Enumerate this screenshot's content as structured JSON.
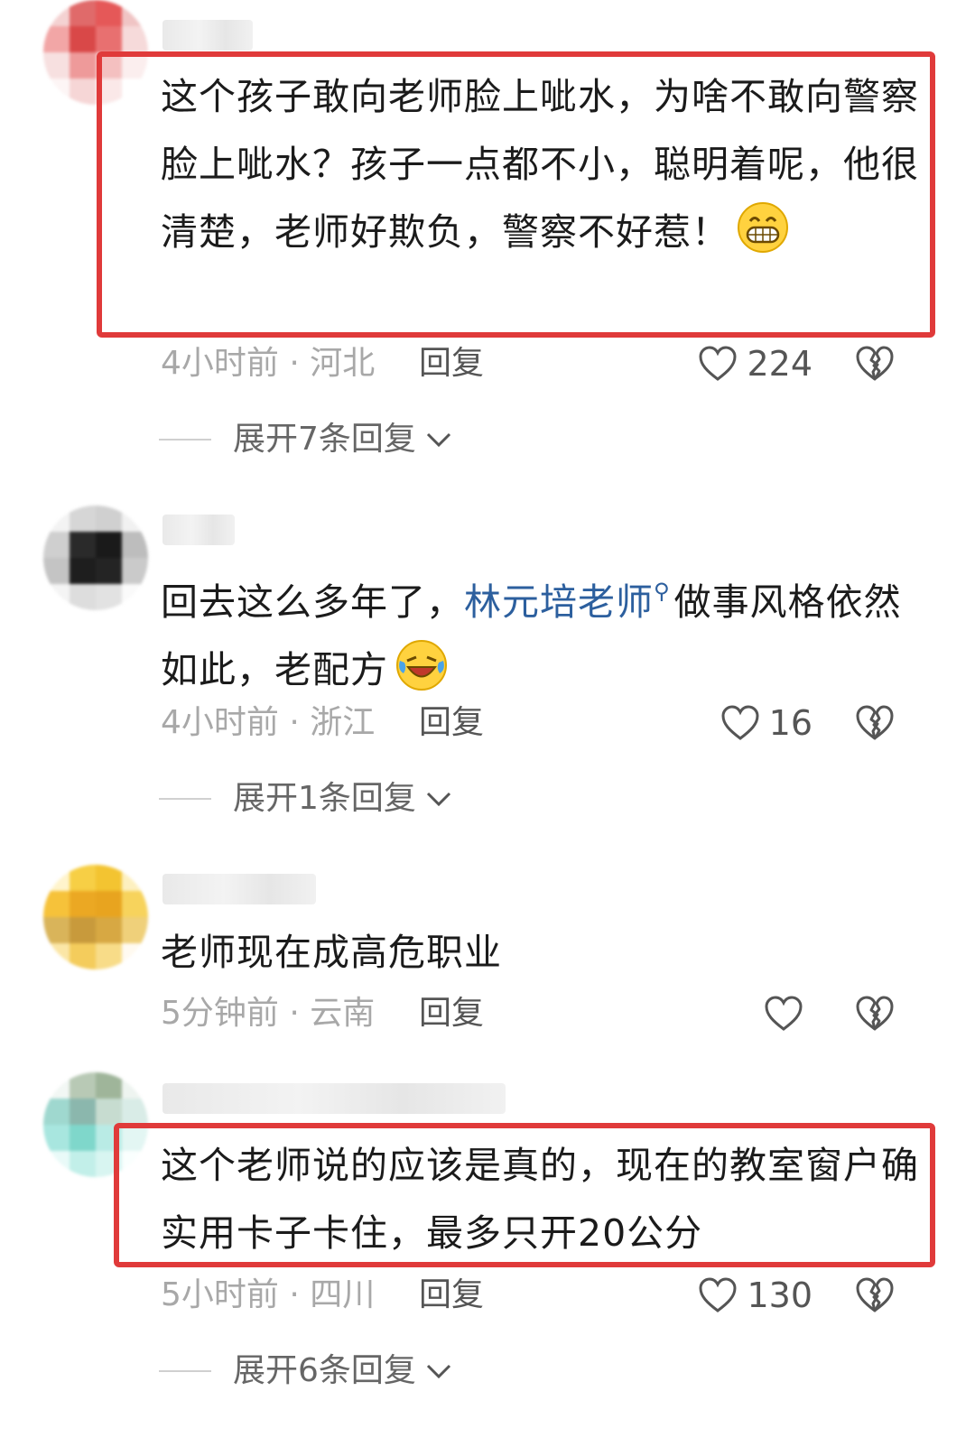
{
  "comments": [
    {
      "text": "这个孩子敢向老师脸上呲水，为啥不敢向警察脸上呲水？孩子一点都不小，聪明着呢，他很清楚，老师好欺负，警察不好惹！",
      "time_location": "4小时前 · 河北",
      "reply_label": "回复",
      "likes": "224",
      "expand_label": "展开7条回复",
      "emoji": "grinning-face"
    },
    {
      "text_before": "回去这么多年了，",
      "link": "林元培老师",
      "text_after": "做事风格依然如此，老配方",
      "time_location": "4小时前 · 浙江",
      "reply_label": "回复",
      "likes": "16",
      "expand_label": "展开1条回复",
      "emoji": "laughing-crying-face"
    },
    {
      "text": "老师现在成高危职业",
      "time_location": "5分钟前 · 云南",
      "reply_label": "回复",
      "likes": ""
    },
    {
      "text": "这个老师说的应该是真的，现在的教室窗户确实用卡子卡住，最多只开20公分",
      "time_location": "5小时前 · 四川",
      "reply_label": "回复",
      "likes": "130",
      "expand_label": "展开6条回复"
    }
  ],
  "colors": {
    "highlight": "#e03a3a",
    "link": "#2c5f9e"
  }
}
